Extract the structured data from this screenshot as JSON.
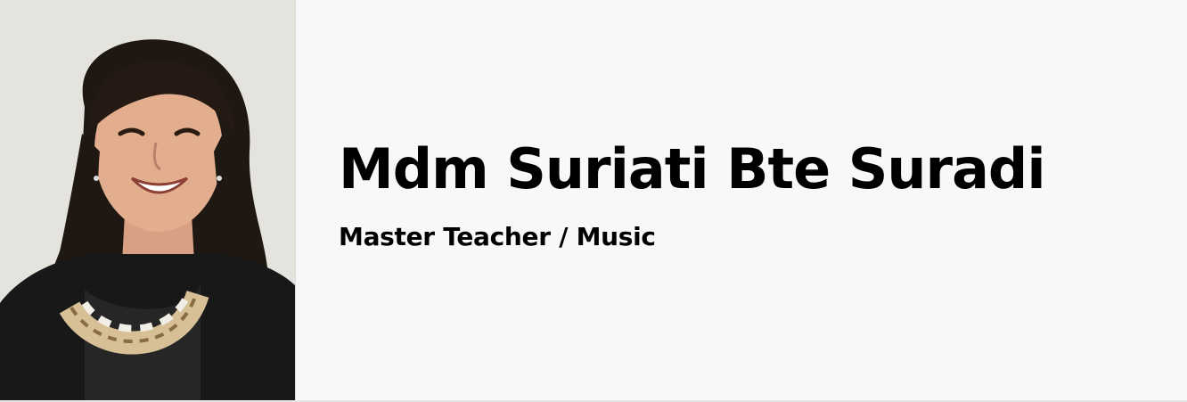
{
  "profile": {
    "name": "Mdm Suriati Bte Suradi",
    "role": "Master Teacher / Music",
    "photo_icon": "portrait-photo"
  },
  "colors": {
    "background": "#f8f8f8",
    "text": "#000000",
    "photo_background": "#e5e4df"
  }
}
